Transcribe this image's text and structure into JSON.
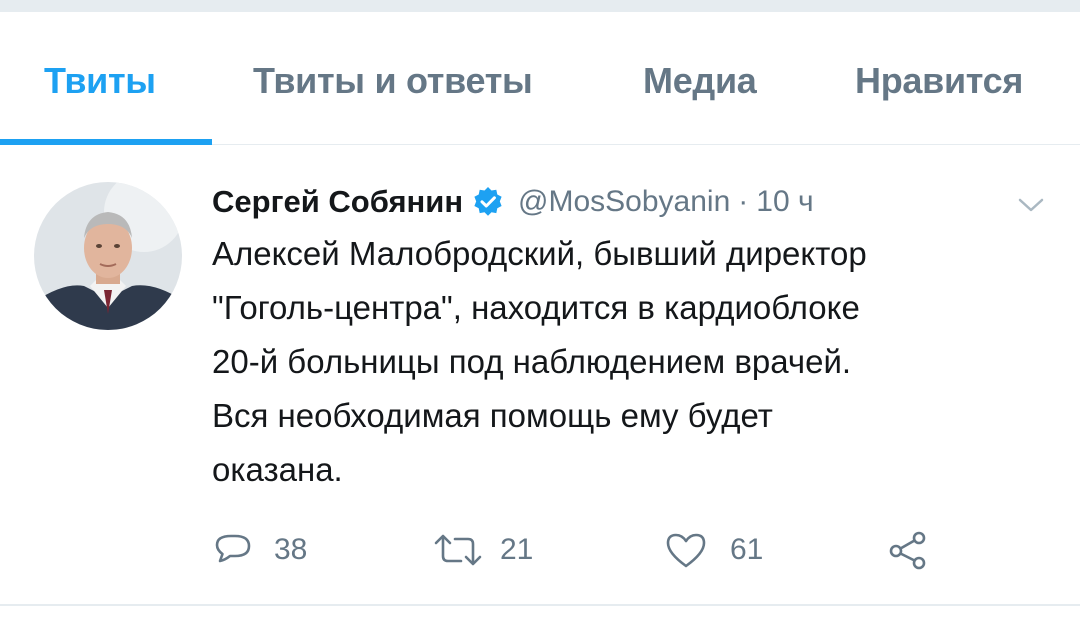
{
  "tabs": [
    {
      "label": "Твиты",
      "active": true
    },
    {
      "label": "Твиты и ответы",
      "active": false
    },
    {
      "label": "Медиа",
      "active": false
    },
    {
      "label": "Нравится",
      "active": false
    }
  ],
  "tweet": {
    "author_name": "Сергей Собянин",
    "verified": true,
    "handle": "@MosSobyanin",
    "separator": "·",
    "time": "10 ч",
    "text": "Алексей Малобродский, бывший директор\n\"Гоголь-центра\", находится в кардиоблоке\n20-й больницы под наблюдением врачей.\nВся необходимая помощь ему будет\nоказана.",
    "replies": "38",
    "retweets": "21",
    "likes": "61"
  },
  "icons": {
    "verified": "verified-badge-icon",
    "menu": "chevron-down-icon",
    "reply": "reply-icon",
    "retweet": "retweet-icon",
    "like": "heart-icon",
    "share": "share-icon"
  },
  "colors": {
    "accent": "#1da1f2",
    "text_primary": "#14171a",
    "text_secondary": "#657786",
    "divider": "#e6ecf0"
  }
}
